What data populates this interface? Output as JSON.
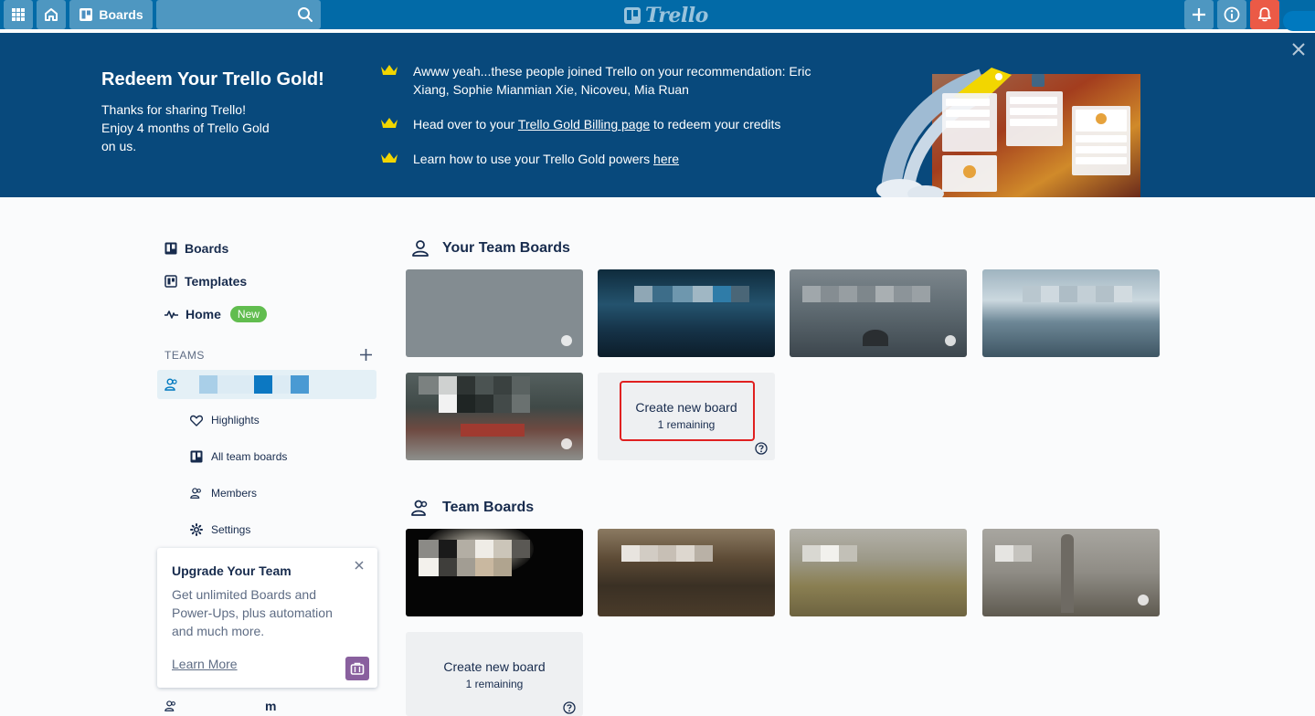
{
  "header": {
    "boards_label": "Boards",
    "logo_text": "Trello",
    "icons": [
      "apps-grid-icon",
      "home-icon",
      "board-icon",
      "search-icon",
      "plus-icon",
      "info-icon",
      "bell-icon"
    ],
    "colors": {
      "bar": "#026aa7",
      "notification": "#eb5a46"
    }
  },
  "banner": {
    "title": "Redeem Your Trello Gold!",
    "sub_lines": [
      "Thanks for sharing Trello!",
      "Enjoy 4 months of Trello Gold",
      "on us."
    ],
    "line1": "Awww yeah...these people joined Trello on your recommendation: Eric Xiang, Sophie Mianmian Xie, Nicoveu, Mia Ruan",
    "line2_pre": "Head over to your ",
    "line2_link": "Trello Gold Billing page",
    "line2_post": " to redeem your credits",
    "line3_pre": "Learn how to use your Trello Gold powers ",
    "line3_link": "here",
    "background": "#08497c"
  },
  "sidebar": {
    "boards": "Boards",
    "templates": "Templates",
    "home": "Home",
    "home_badge": "New",
    "teams_label": "TEAMS",
    "team_sub": {
      "highlights": "Highlights",
      "all_boards": "All team boards",
      "members": "Members",
      "settings": "Settings"
    },
    "upgrade": {
      "title": "Upgrade Your Team",
      "text": "Get unlimited Boards and Power-Ups, plus automation and much more.",
      "link": "Learn More"
    },
    "bottom_team_partial": "m"
  },
  "main": {
    "your_team_boards": "Your Team Boards",
    "team_boards": "Team Boards",
    "create_title": "Create new board",
    "create_remaining": "1 remaining",
    "create_title_2": "Create new board",
    "create_remaining_2": "1 remaining"
  }
}
